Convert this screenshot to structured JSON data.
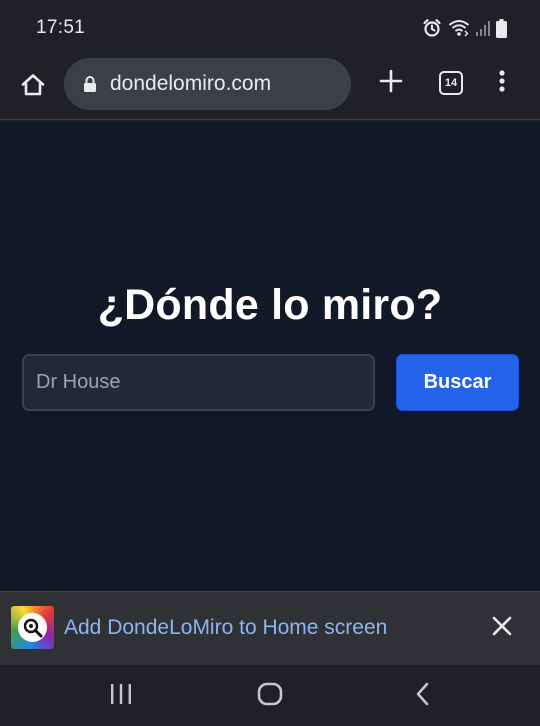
{
  "status_bar": {
    "time": "17:51",
    "icons": [
      "alarm-icon",
      "wifi-icon",
      "signal-icon",
      "battery-icon"
    ]
  },
  "toolbar": {
    "url": "dondelomiro.com",
    "tab_count": "14",
    "icons": [
      "home-icon",
      "lock-icon",
      "plus-icon",
      "tabs-icon",
      "more-vert-icon"
    ]
  },
  "page": {
    "heading": "¿Dónde lo miro?",
    "search_placeholder": "Dr House",
    "search_value": "",
    "search_button": "Buscar",
    "colors": {
      "background": "#111827",
      "input_bg": "#1f2937",
      "button": "#2563eb"
    }
  },
  "banner": {
    "text": "Add DondeLoMiro to Home screen",
    "icons": [
      "app-icon",
      "close-icon"
    ]
  },
  "nav_bar": {
    "icons": [
      "recent-apps-icon",
      "home-nav-icon",
      "back-icon"
    ]
  }
}
